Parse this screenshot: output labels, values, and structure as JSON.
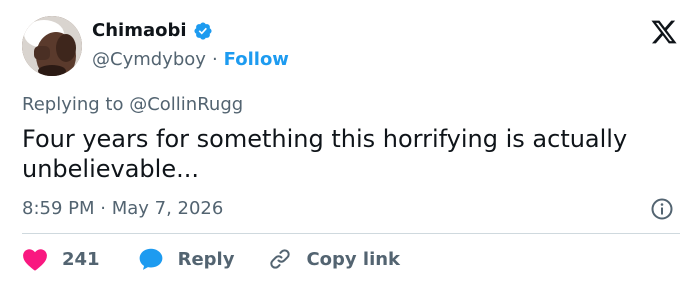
{
  "user": {
    "display_name": "Chimaobi",
    "handle": "@Cymdyboy",
    "separator": "·",
    "follow_label": "Follow"
  },
  "replying": {
    "prefix": "Replying to",
    "mention": "@CollinRugg"
  },
  "tweet": {
    "text": "Four years for something this horrifying is actually unbelievable...",
    "time": "8:59 PM · May 7, 2026"
  },
  "actions": {
    "like_count": "241",
    "reply_label": "Reply",
    "copy_label": "Copy link"
  },
  "colors": {
    "accent": "#1d9bf0",
    "like": "#f91880",
    "muted": "#536471",
    "text": "#0f1419"
  },
  "icons": [
    "verified-badge-icon",
    "x-logo-icon",
    "info-icon",
    "heart-icon",
    "reply-bubble-icon",
    "link-icon"
  ]
}
